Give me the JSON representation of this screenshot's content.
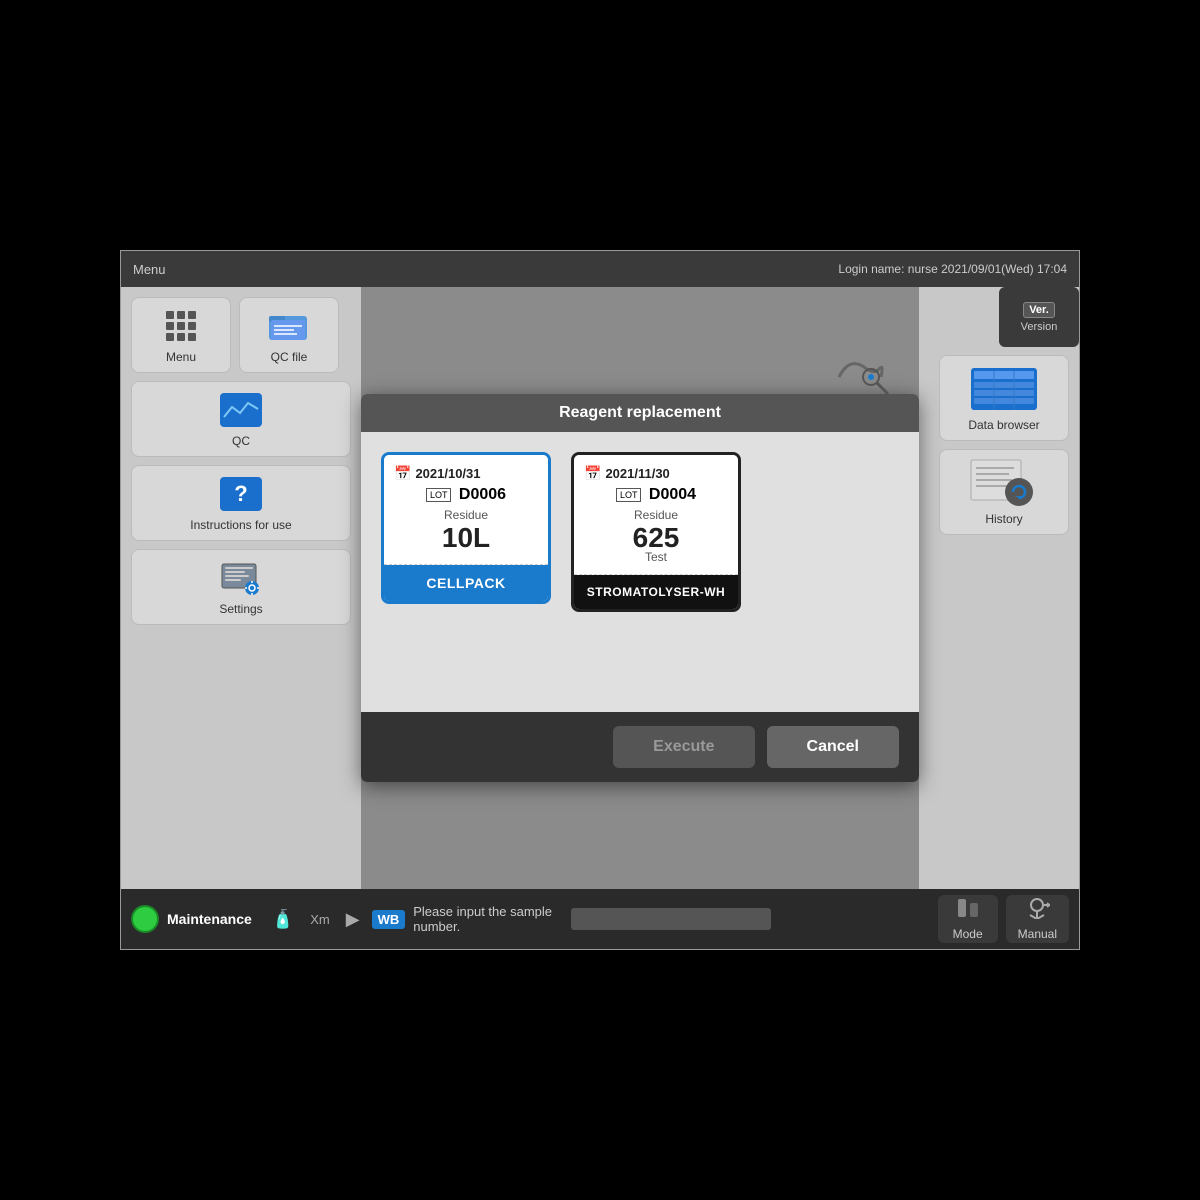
{
  "topbar": {
    "menu_label": "Menu",
    "info_text": "Login name: nurse    2021/09/01(Wed) 17:04"
  },
  "sidebar": {
    "items": [
      {
        "id": "menu",
        "label": "Menu",
        "icon": "grid-icon"
      },
      {
        "id": "qc-file",
        "label": "QC file",
        "icon": "folder-icon"
      },
      {
        "id": "qc",
        "label": "QC",
        "icon": "chart-icon"
      },
      {
        "id": "instructions",
        "label": "Instructions for use",
        "icon": "help-icon"
      },
      {
        "id": "settings",
        "label": "Settings",
        "icon": "settings-icon"
      }
    ]
  },
  "right_sidebar": {
    "items": [
      {
        "id": "data-browser",
        "label": "Data browser",
        "icon": "table-icon"
      },
      {
        "id": "history",
        "label": "History",
        "icon": "history-icon"
      }
    ],
    "version": {
      "badge": "Ver.",
      "label": "Version"
    }
  },
  "modal": {
    "title": "Reagent replacement",
    "reagents": [
      {
        "id": "cellpack",
        "date": "2021/10/31",
        "lot": "D0006",
        "residue_label": "Residue",
        "residue_value": "10L",
        "name": "CELLPACK",
        "style": "blue"
      },
      {
        "id": "stromatolyser",
        "date": "2021/11/30",
        "lot": "D0004",
        "residue_label": "Residue",
        "residue_value": "625",
        "residue_unit": "Test",
        "name": "STROMATOLYSER-WH",
        "style": "dark"
      }
    ],
    "execute_btn": "Execute",
    "cancel_btn": "Cancel"
  },
  "bottombar": {
    "status": "Maintenance",
    "wb_badge": "WB",
    "message": "Please input the sample number.",
    "mode_btn": "Mode",
    "manual_btn": "Manual"
  }
}
